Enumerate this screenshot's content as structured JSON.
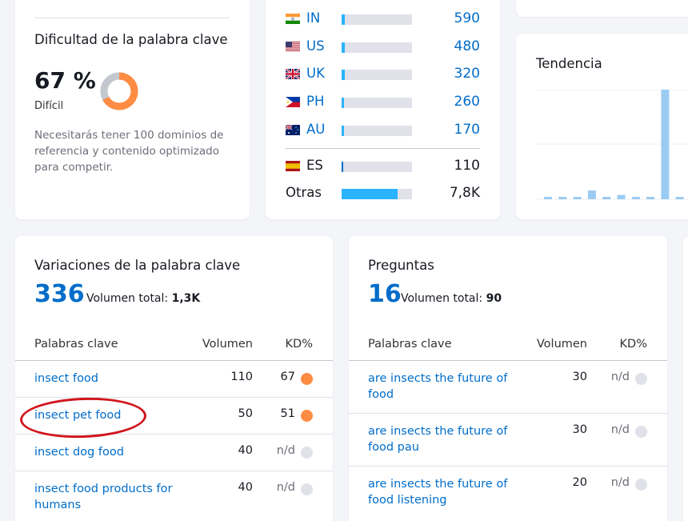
{
  "kd_card": {
    "title": "Dificultad de la palabra clave",
    "value": "67 %",
    "level": "Difícil",
    "description": "Necesitarás tener 100 dominios de referencia y contenido optimizado para competir.",
    "color": "#ff8c43"
  },
  "countries": {
    "rows": [
      {
        "code": "IN",
        "flag": "india-flag-icon",
        "value": "590",
        "share": 0.05
      },
      {
        "code": "US",
        "flag": "usa-flag-icon",
        "value": "480",
        "share": 0.04
      },
      {
        "code": "UK",
        "flag": "uk-flag-icon",
        "value": "320",
        "share": 0.04
      },
      {
        "code": "PH",
        "flag": "philippines-flag-icon",
        "value": "260",
        "share": 0.03
      },
      {
        "code": "AU",
        "flag": "australia-flag-icon",
        "value": "170",
        "share": 0.03
      }
    ],
    "current": {
      "code": "ES",
      "flag": "spain-flag-icon",
      "value": "110",
      "share": 0.02
    },
    "others": {
      "label": "Otras",
      "value": "7,8K",
      "share": 0.8
    }
  },
  "trend": {
    "title": "Tendencia",
    "values": [
      0.02,
      0.02,
      0.02,
      0.08,
      0.02,
      0.04,
      0.02,
      0.02,
      1.0,
      0.02,
      0.02
    ]
  },
  "variations": {
    "title": "Variaciones de la palabra clave",
    "count": "336",
    "total_label": "Volumen total:",
    "total_value": "1,3K",
    "headers": {
      "keyword": "Palabras clave",
      "volume": "Volumen",
      "kd": "KD%"
    },
    "rows": [
      {
        "keyword": "insect food",
        "volume": "110",
        "kd": "67",
        "kd_color": "orange"
      },
      {
        "keyword": "insect pet food",
        "volume": "50",
        "kd": "51",
        "kd_color": "orange"
      },
      {
        "keyword": "insect dog food",
        "volume": "40",
        "kd": "n/d",
        "kd_color": "grey"
      },
      {
        "keyword": "insect food products for humans",
        "volume": "40",
        "kd": "n/d",
        "kd_color": "grey"
      }
    ]
  },
  "questions": {
    "title": "Preguntas",
    "count": "16",
    "total_label": "Volumen total:",
    "total_value": "90",
    "headers": {
      "keyword": "Palabras clave",
      "volume": "Volumen",
      "kd": "KD%"
    },
    "rows": [
      {
        "keyword": "are insects the future of food",
        "volume": "30",
        "kd": "n/d",
        "kd_color": "grey"
      },
      {
        "keyword": "are insects the future of food pau",
        "volume": "30",
        "kd": "n/d",
        "kd_color": "grey"
      },
      {
        "keyword": "are insects the future of food listening",
        "volume": "20",
        "kd": "n/d",
        "kd_color": "grey"
      }
    ]
  },
  "colors": {
    "link": "#006dca",
    "bar_fill": "#2bb3ff",
    "bar_dark": "#006dca",
    "bar_track": "#e0e1e9",
    "kd_orange": "#ff8c43",
    "annotation": "#d0161c",
    "trend_bar": "#9ccbf2"
  }
}
